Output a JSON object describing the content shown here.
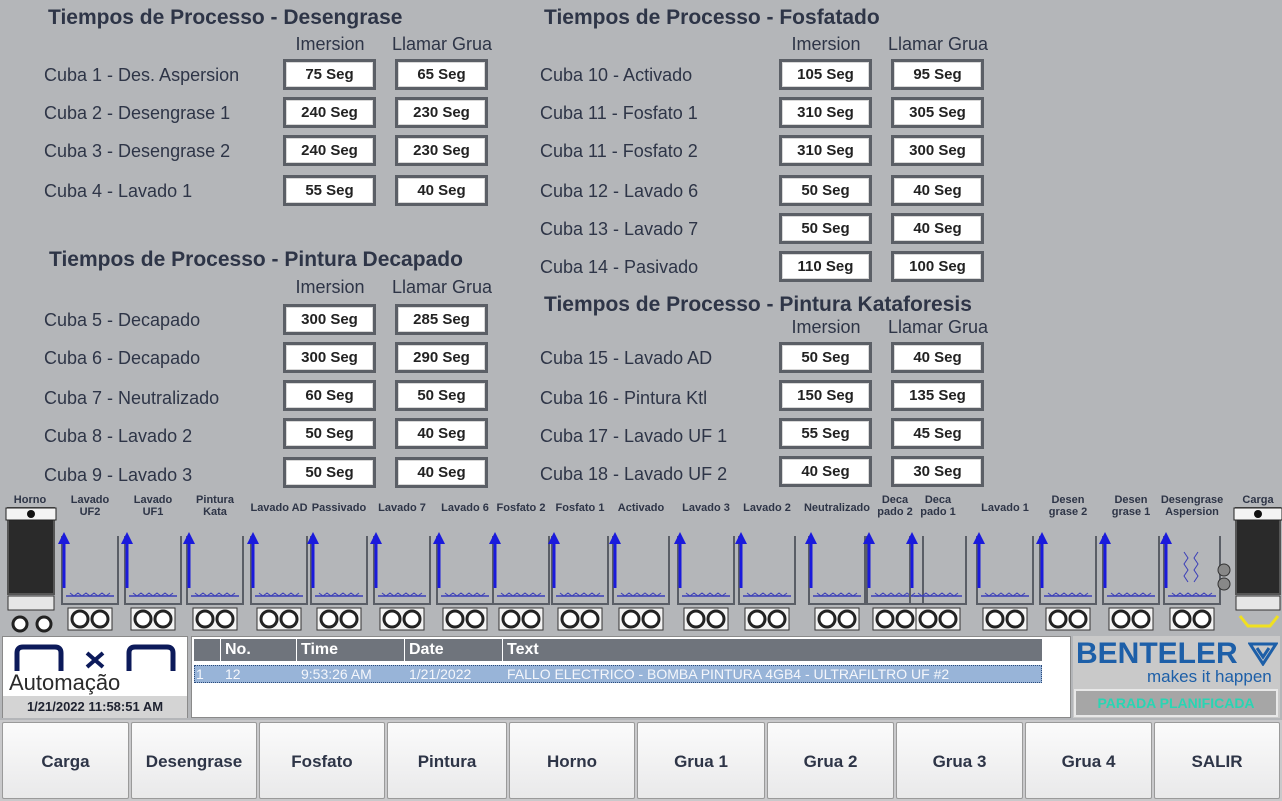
{
  "desengrase": {
    "title": "Tiempos de Processo - Desengrase",
    "col_imersion": "Imersion",
    "col_grua": "Llamar Grua",
    "rows": [
      {
        "label": "Cuba 1 - Des. Aspersion",
        "imersion": "75 Seg",
        "grua": "65 Seg"
      },
      {
        "label": "Cuba 2 - Desengrase 1",
        "imersion": "240 Seg",
        "grua": "230 Seg"
      },
      {
        "label": "Cuba 3 - Desengrase 2",
        "imersion": "240 Seg",
        "grua": "230 Seg"
      },
      {
        "label": "Cuba 4 - Lavado 1",
        "imersion": "55 Seg",
        "grua": "40 Seg"
      }
    ]
  },
  "decapado": {
    "title": "Tiempos de Processo - Pintura Decapado",
    "col_imersion": "Imersion",
    "col_grua": "Llamar Grua",
    "rows": [
      {
        "label": "Cuba 5 - Decapado",
        "imersion": "300 Seg",
        "grua": "285 Seg"
      },
      {
        "label": "Cuba 6 - Decapado",
        "imersion": "300 Seg",
        "grua": "290 Seg"
      },
      {
        "label": "Cuba 7 - Neutralizado",
        "imersion": "60 Seg",
        "grua": "50 Seg"
      },
      {
        "label": "Cuba 8 - Lavado 2",
        "imersion": "50 Seg",
        "grua": "40 Seg"
      },
      {
        "label": "Cuba 9 - Lavado 3",
        "imersion": "50 Seg",
        "grua": "40 Seg"
      }
    ]
  },
  "fosfatado": {
    "title": "Tiempos de Processo - Fosfatado",
    "col_imersion": "Imersion",
    "col_grua": "Llamar Grua",
    "rows": [
      {
        "label": "Cuba 10 - Activado",
        "imersion": "105 Seg",
        "grua": "95 Seg"
      },
      {
        "label": "Cuba 11 - Fosfato 1",
        "imersion": "310 Seg",
        "grua": "305 Seg"
      },
      {
        "label": "Cuba 11 - Fosfato 2",
        "imersion": "310 Seg",
        "grua": "300 Seg"
      },
      {
        "label": "Cuba 12 - Lavado 6",
        "imersion": "50 Seg",
        "grua": "40 Seg"
      },
      {
        "label": "Cuba 13 - Lavado 7",
        "imersion": "50 Seg",
        "grua": "40 Seg"
      },
      {
        "label": "Cuba 14 - Pasivado",
        "imersion": "110 Seg",
        "grua": "100 Seg"
      }
    ]
  },
  "kataforesis": {
    "title": "Tiempos de Processo - Pintura Kataforesis",
    "col_imersion": "Imersion",
    "col_grua": "Llamar Grua",
    "rows": [
      {
        "label": "Cuba 15 - Lavado AD",
        "imersion": "50 Seg",
        "grua": "40 Seg"
      },
      {
        "label": "Cuba 16 - Pintura Ktl",
        "imersion": "150 Seg",
        "grua": "135 Seg"
      },
      {
        "label": "Cuba 17 - Lavado UF 1",
        "imersion": "55 Seg",
        "grua": "45 Seg"
      },
      {
        "label": "Cuba 18 - Lavado UF 2",
        "imersion": "40 Seg",
        "grua": "30 Seg"
      }
    ]
  },
  "strip": {
    "horno": "Horno",
    "carga": "Carga",
    "tanks": [
      {
        "l1": "Lavado",
        "l2": "UF2"
      },
      {
        "l1": "Lavado",
        "l2": "UF1"
      },
      {
        "l1": "Pintura",
        "l2": "Kata"
      },
      {
        "l1": "Lavado AD",
        "l2": ""
      },
      {
        "l1": "Passivado",
        "l2": ""
      },
      {
        "l1": "Lavado 7",
        "l2": ""
      },
      {
        "l1": "Lavado 6",
        "l2": ""
      },
      {
        "l1": "Fosfato 2",
        "l2": ""
      },
      {
        "l1": "Fosfato 1",
        "l2": ""
      },
      {
        "l1": "Activado",
        "l2": ""
      },
      {
        "l1": "Lavado 3",
        "l2": ""
      },
      {
        "l1": "Lavado 2",
        "l2": ""
      },
      {
        "l1": "Neutralizado",
        "l2": ""
      },
      {
        "l1": "Deca",
        "l2": "pado 2"
      },
      {
        "l1": "Deca",
        "l2": "pado 1"
      },
      {
        "l1": "Lavado 1",
        "l2": ""
      },
      {
        "l1": "Desen",
        "l2": "grase 2"
      },
      {
        "l1": "Desen",
        "l2": "grase 1"
      },
      {
        "l1": "Desengrase",
        "l2": "Aspersion"
      }
    ]
  },
  "logo": {
    "brand": "Automação",
    "datetime": "1/21/2022 11:58:51 AM"
  },
  "alarms": {
    "headers": {
      "no": "No.",
      "time": "Time",
      "date": "Date",
      "text": "Text"
    },
    "rows": [
      {
        "idx": "1",
        "no": "12",
        "time": "9:53:26 AM",
        "date": "1/21/2022",
        "text": "FALLO ELECTRICO - BOMBA PINTURA 4GB4 - ULTRAFILTRO UF #2"
      }
    ]
  },
  "brand": {
    "name": "BENTELER",
    "slogan": "makes it happen",
    "status": "PARADA PLANIFICADA"
  },
  "nav": [
    "Carga",
    "Desengrase",
    "Fosfato",
    "Pintura",
    "Horno",
    "Grua 1",
    "Grua 2",
    "Grua 3",
    "Grua 4",
    "SALIR"
  ],
  "colors": {
    "arrow": "#1a1adc",
    "status_text": "#29d5b3",
    "benteler_blue": "#1d5fa8"
  }
}
